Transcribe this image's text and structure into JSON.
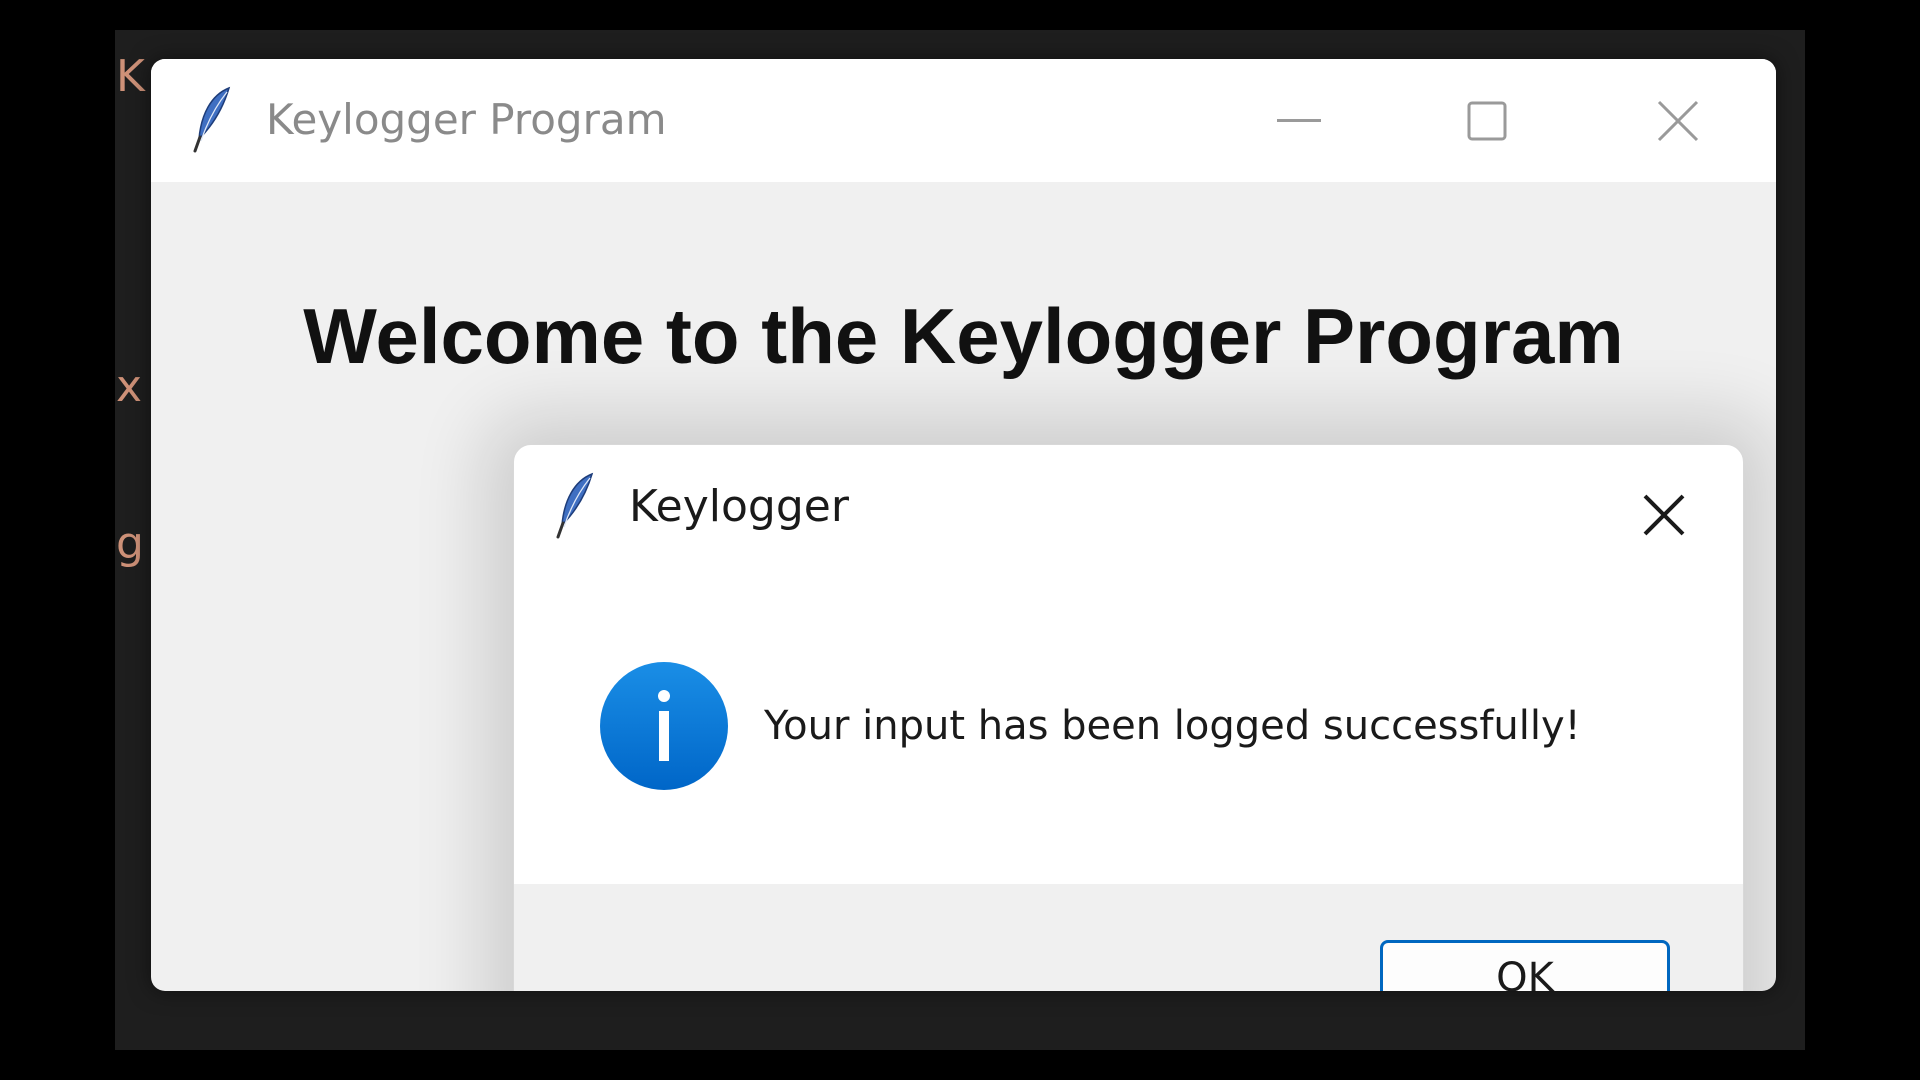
{
  "background_editor": {
    "visible_chars": [
      "K",
      "x",
      "g"
    ]
  },
  "main_window": {
    "title": "Keylogger Program",
    "icon": "feather-icon",
    "controls": {
      "minimize": "minimize-icon",
      "maximize": "maximize-icon",
      "close": "close-icon"
    },
    "heading": "Welcome to the Keylogger Program"
  },
  "dialog": {
    "title": "Keylogger",
    "icon": "feather-icon",
    "close_icon": "close-icon",
    "info_icon": "info-icon",
    "message": "Your input has been logged successfully!",
    "ok_label": "OK"
  },
  "colors": {
    "accent": "#0067c0",
    "info_blue": "#0a78d4",
    "editor_text": "#ce9178"
  }
}
